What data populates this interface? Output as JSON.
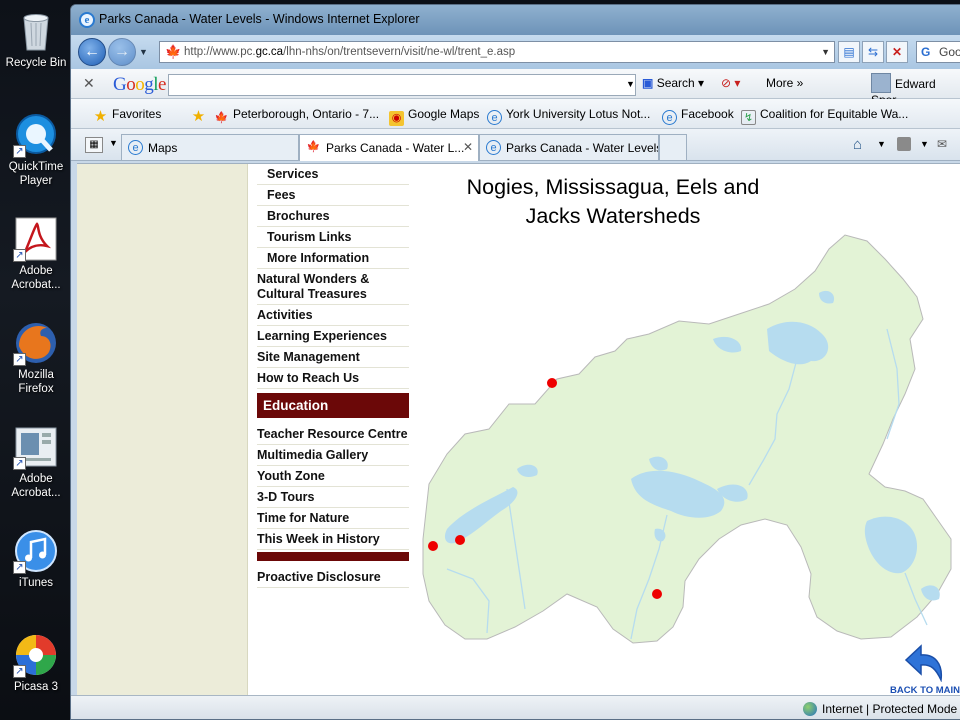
{
  "desktop": {
    "icons": [
      {
        "label": "Recycle Bin"
      },
      {
        "label": "QuickTime Player"
      },
      {
        "label": "Adobe Acrobat..."
      },
      {
        "label": "Mozilla Firefox"
      },
      {
        "label": "Adobe Acrobat..."
      },
      {
        "label": "iTunes"
      },
      {
        "label": "Picasa 3"
      }
    ]
  },
  "window": {
    "title": "Parks Canada - Water Levels - Windows Internet Explorer",
    "address_prefix": "http://www.pc.",
    "address_domain": "gc.ca",
    "address_path": "/lhn-nhs/on/trentsevern/visit/ne-wl/trent_e.asp",
    "search_stub": "Goo"
  },
  "google_toolbar": {
    "logo": "Google",
    "search_value": "",
    "search_label": "Search",
    "more_label": "More",
    "user_name": "Edward Sper"
  },
  "favorites": {
    "label": "Favorites",
    "items": [
      "Peterborough, Ontario - 7...",
      "Google Maps",
      "York University  Lotus Not...",
      "Facebook",
      "Coalition for Equitable Wa..."
    ]
  },
  "tabs": [
    {
      "label": "Maps",
      "active": false
    },
    {
      "label": "Parks Canada - Water L...",
      "active": true
    },
    {
      "label": "Parks Canada - Water Levels",
      "active": false
    }
  ],
  "menu": {
    "items": [
      {
        "label": "Services",
        "level": "sub"
      },
      {
        "label": "Fees",
        "level": "sub"
      },
      {
        "label": "Brochures",
        "level": "sub"
      },
      {
        "label": "Tourism Links",
        "level": "sub"
      },
      {
        "label": "More Information",
        "level": "sub"
      },
      {
        "label": "Natural Wonders & Cultural Treasures",
        "level": "top"
      },
      {
        "label": "Activities",
        "level": "top"
      },
      {
        "label": "Learning Experiences",
        "level": "top"
      },
      {
        "label": "Site Management",
        "level": "top"
      },
      {
        "label": "How to Reach Us",
        "level": "top"
      },
      {
        "label": "Education",
        "level": "head"
      },
      {
        "label": "Teacher Resource Centre",
        "level": "top"
      },
      {
        "label": "Multimedia Gallery",
        "level": "top"
      },
      {
        "label": "Youth Zone",
        "level": "top"
      },
      {
        "label": "3-D Tours",
        "level": "top"
      },
      {
        "label": "Time for Nature",
        "level": "top"
      },
      {
        "label": "This Week in History",
        "level": "top"
      },
      {
        "label": "",
        "level": "bar"
      },
      {
        "label": "Proactive Disclosure",
        "level": "top"
      }
    ]
  },
  "map": {
    "title_line1": "Nogies, Mississagua, Eels and",
    "title_line2": "Jacks Watersheds",
    "land_color": "#e3f3d6",
    "water_color": "#b6dcef",
    "station_color": "#ee0000",
    "stations": 5,
    "back_label": "BACK TO MAIN"
  },
  "status": {
    "zone_label": "Internet | Protected Mode"
  }
}
